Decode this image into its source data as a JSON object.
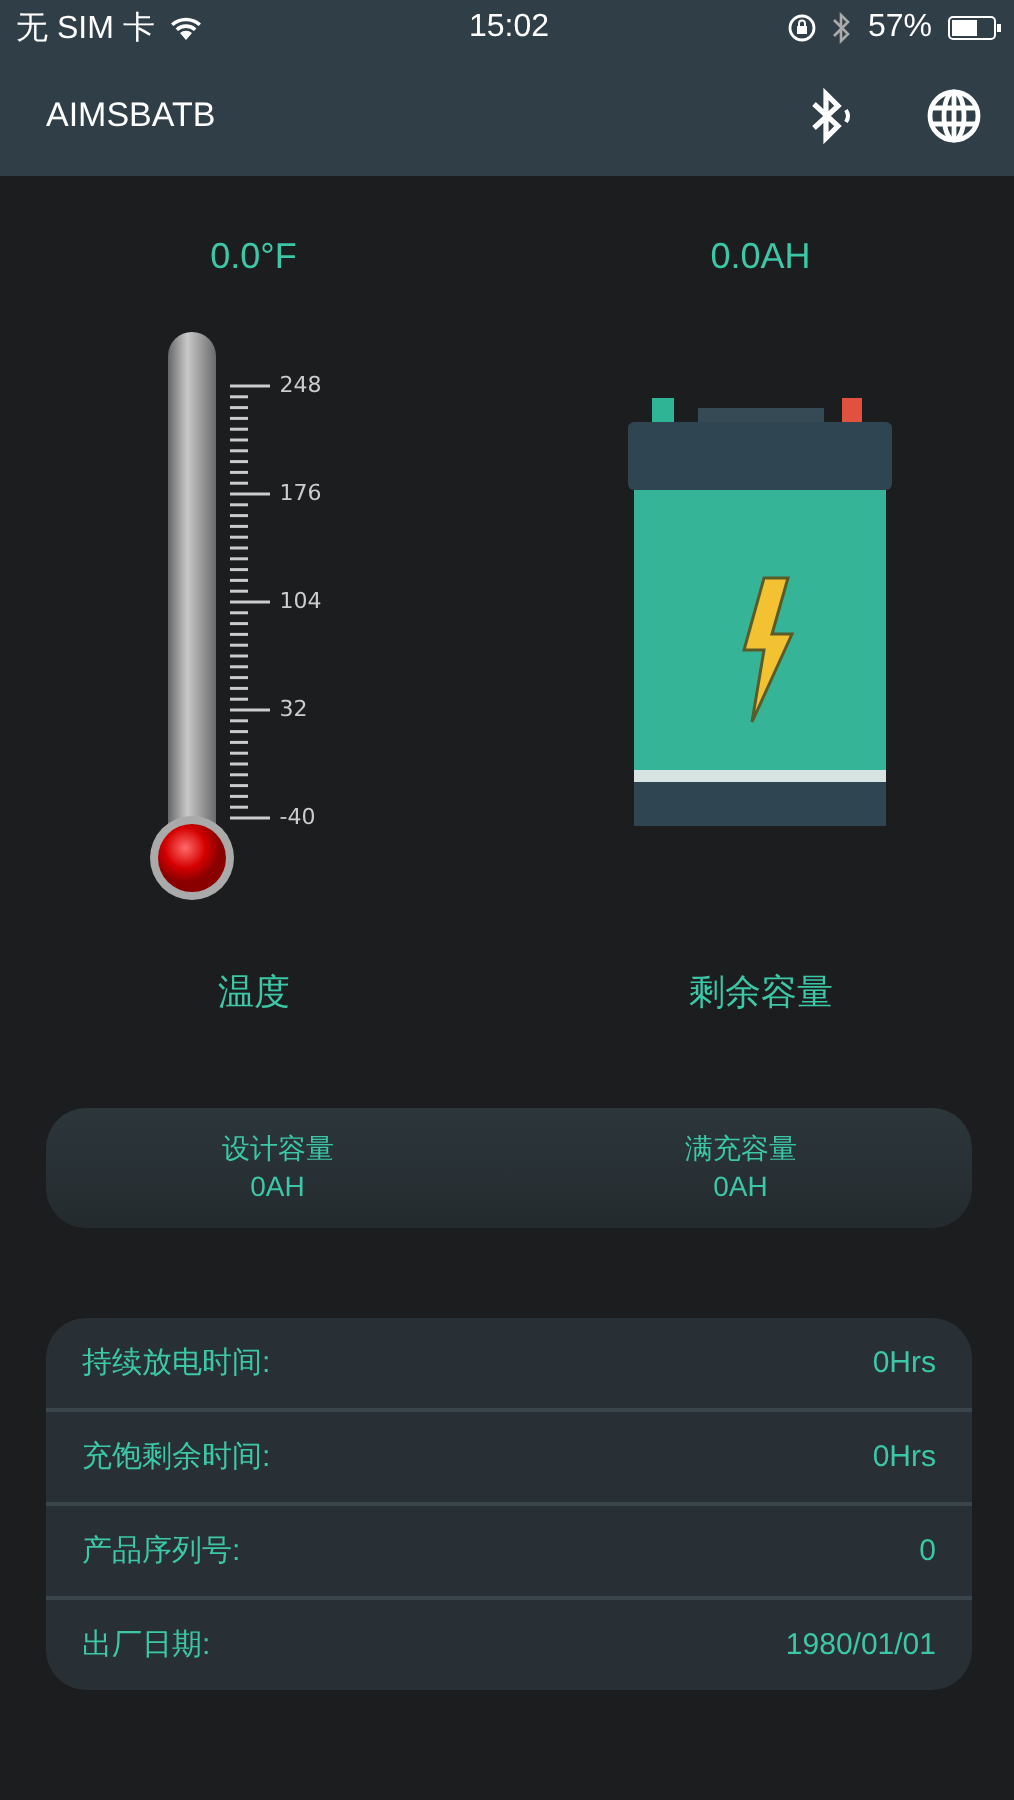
{
  "status_bar": {
    "carrier": "无 SIM 卡",
    "time": "15:02",
    "battery": "57%"
  },
  "nav_bar": {
    "title": "AIMSBATB"
  },
  "gauges": [
    {
      "kind": "thermometer",
      "value": "0.0°F",
      "label": "温度",
      "scale": [
        "248",
        "176",
        "104",
        "32",
        "-40"
      ]
    },
    {
      "kind": "battery",
      "value": "0.0AH",
      "label": "剩余容量"
    }
  ],
  "capacity": [
    {
      "label": "设计容量",
      "value": "0AH"
    },
    {
      "label": "满充容量",
      "value": "0AH"
    }
  ],
  "info_rows": [
    {
      "label": "持续放电时间:",
      "value": "0Hrs"
    },
    {
      "label": "充饱剩余时间:",
      "value": "0Hrs"
    },
    {
      "label": "产品序列号:",
      "value": "0"
    },
    {
      "label": "出厂日期:",
      "value": "1980/01/01"
    }
  ]
}
